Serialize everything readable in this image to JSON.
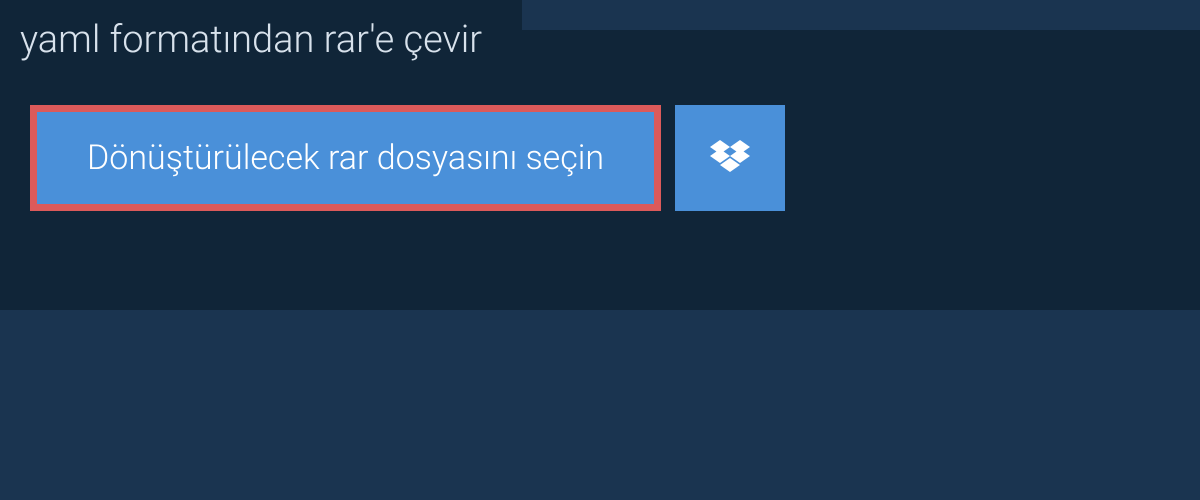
{
  "header": {
    "title": "yaml formatından rar'e çevir"
  },
  "actions": {
    "file_select_label": "Dönüştürülecek rar dosyasını seçin"
  },
  "colors": {
    "page_bg": "#1a3450",
    "panel_bg": "#102538",
    "button_bg": "#4a90d9",
    "highlight_border": "#dc5a5a",
    "text_light": "#d8e2ec",
    "text_white": "#ffffff"
  }
}
